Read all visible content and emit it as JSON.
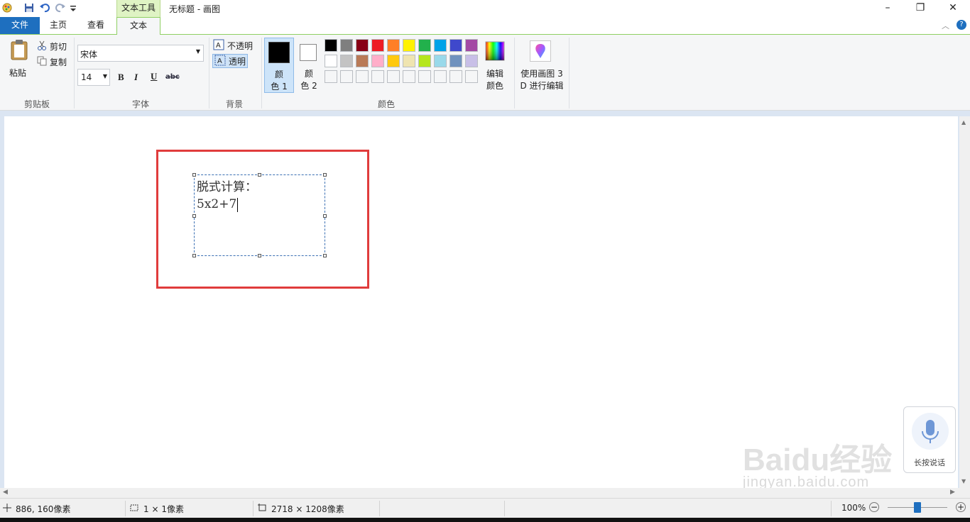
{
  "window": {
    "title": "无标题 - 画图",
    "context_tab": "文本工具",
    "minimize": "–",
    "restore": "❐",
    "close": "✕"
  },
  "tabs": [
    "文件",
    "主页",
    "查看",
    "文本"
  ],
  "ribbon": {
    "clipboard": {
      "paste": "粘贴",
      "cut": "剪切",
      "copy": "复制",
      "label": "剪贴板"
    },
    "font": {
      "family": "宋体",
      "size": "14",
      "bold": "B",
      "italic": "I",
      "underline": "U",
      "strike": "abc",
      "label": "字体"
    },
    "background": {
      "opaque": "不透明",
      "transparent": "透明",
      "label": "背景"
    },
    "colors": {
      "color1_line1": "颜",
      "color1_line2": "色 1",
      "color2_line1": "颜",
      "color2_line2": "色 2",
      "edit_line1": "编辑",
      "edit_line2": "颜色",
      "label": "颜色",
      "color1": "#000000",
      "color2": "#ffffff",
      "palette_row1": [
        "#000000",
        "#7f7f7f",
        "#880015",
        "#ed1c24",
        "#ff7f27",
        "#fff200",
        "#22b14c",
        "#00a2e8",
        "#3f48cc",
        "#a349a4"
      ],
      "palette_row2": [
        "#ffffff",
        "#c3c3c3",
        "#b97a57",
        "#ffaec9",
        "#ffc90e",
        "#efe4b0",
        "#b5e61d",
        "#99d9ea",
        "#7092be",
        "#c8bfe7"
      ],
      "palette_row3": [
        "#f5f6f7",
        "#f5f6f7",
        "#f5f6f7",
        "#f5f6f7",
        "#f5f6f7",
        "#f5f6f7",
        "#f5f6f7",
        "#f5f6f7",
        "#f5f6f7",
        "#f5f6f7"
      ]
    },
    "paint3d": {
      "line1": "使用画图 3",
      "line2": "D 进行编辑"
    }
  },
  "canvas": {
    "text_line1": "脱式计算：",
    "text_line2": "5x2+7",
    "highlight_color": "#e03c3c"
  },
  "status": {
    "cursor": "886, 160像素",
    "selection": "1 × 1像素",
    "size": "2718 × 1208像素",
    "zoom": "100%",
    "zoom_minus": "−",
    "zoom_plus": "+",
    "zoom_level": 0.5
  },
  "overlay": {
    "voice_label": "长按说话",
    "watermark_main": "Baidu经验",
    "watermark_sub": "jingyan.baidu.com"
  }
}
